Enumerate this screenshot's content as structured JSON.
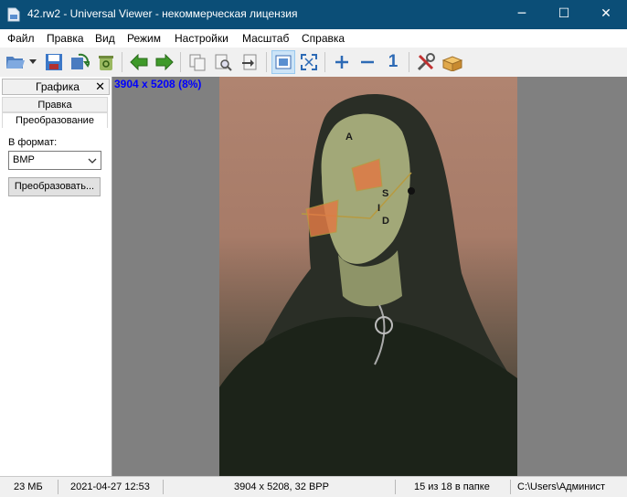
{
  "window": {
    "title": "42.rw2 - Universal Viewer - некоммерческая лицензия",
    "controls": {
      "minimize": "─",
      "maximize": "☐",
      "close": "✕"
    }
  },
  "menu": [
    "Файл",
    "Правка",
    "Вид",
    "Режим",
    "Настройки",
    "Масштаб",
    "Справка"
  ],
  "toolbar": {
    "icons": [
      "open-folder-icon",
      "dropdown-arrow-icon",
      "save-icon",
      "reload-icon",
      "recycle-bin-icon",
      "previous-arrow-icon",
      "next-arrow-icon",
      "copy-icon",
      "print-preview-icon",
      "move-to-icon",
      "fit-window-icon",
      "fullscreen-icon",
      "zoom-in-icon",
      "zoom-out-icon",
      "actual-size-icon",
      "tools-icon",
      "package-icon"
    ],
    "actual_size_label": "1"
  },
  "panel": {
    "header": "Графика",
    "close": "✕",
    "tabs": [
      "Правка",
      "Преобразование"
    ],
    "format_label": "В формат:",
    "format_value": "BMP",
    "convert_button": "Преобразовать..."
  },
  "viewer": {
    "overlay": "3904 x 5208 (8%)",
    "face_text": {
      "a": "A",
      "s": "S",
      "i": "I",
      "d": "D"
    }
  },
  "status": {
    "size": "23 МБ",
    "date": "2021-04-27 12:53",
    "dims": "3904 x 5208, 32 BPP",
    "position": "15 из 18 в папке",
    "path": "C:\\Users\\Админист"
  },
  "colors": {
    "titlebar": "#0b4e77",
    "overlay_text": "#0000ff",
    "viewer_bg": "#808080"
  }
}
